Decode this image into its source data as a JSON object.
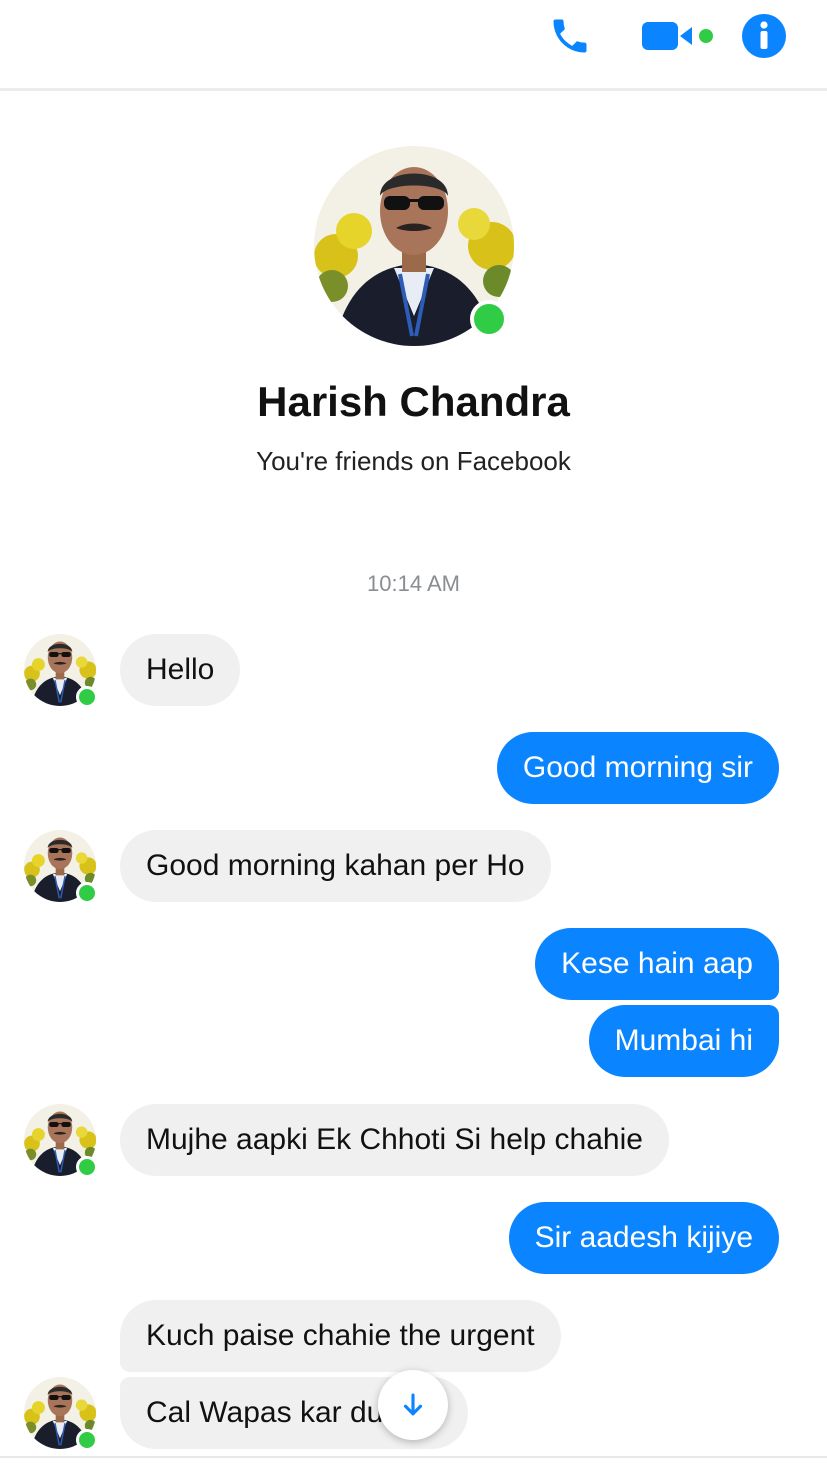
{
  "header": {
    "icons": [
      "phone-icon",
      "video-camera-icon",
      "info-icon"
    ],
    "accent_color": "#0a84ff",
    "online_color": "#31cc46"
  },
  "profile": {
    "name": "Harish Chandra",
    "subtitle": "You're friends on Facebook",
    "online": true
  },
  "conversation": {
    "timestamp": "10:14 AM",
    "messages": [
      {
        "from": "them",
        "text": "Hello"
      },
      {
        "from": "me",
        "text": "Good morning sir"
      },
      {
        "from": "them",
        "text": "Good morning kahan per Ho"
      },
      {
        "from": "me",
        "text": "Kese hain aap"
      },
      {
        "from": "me",
        "text": "Mumbai hi"
      },
      {
        "from": "them",
        "text": "Mujhe aapki Ek Chhoti Si help chahie"
      },
      {
        "from": "me",
        "text": "Sir aadesh kijiye"
      },
      {
        "from": "them",
        "text": "Kuch paise chahie the urgent"
      },
      {
        "from": "them",
        "text": "Cal Wapas kar du"
      }
    ]
  },
  "scroll_button": {
    "icon": "arrow-down-icon"
  }
}
